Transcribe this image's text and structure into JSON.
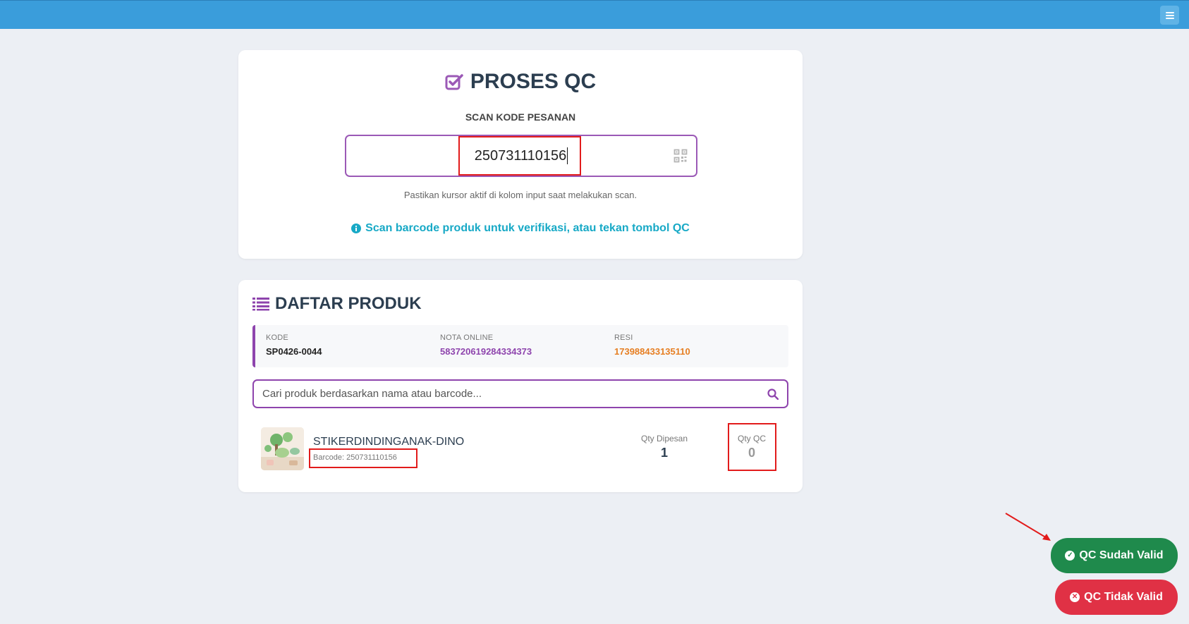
{
  "qc": {
    "title": "PROSES QC",
    "scan_label": "SCAN KODE PESANAN",
    "scan_value": "250731110156",
    "hint": "Pastikan kursor aktif di kolom input saat melakukan scan.",
    "info": "Scan barcode produk untuk verifikasi, atau tekan tombol QC"
  },
  "products": {
    "title": "DAFTAR PRODUK",
    "meta": {
      "kode_label": "KODE",
      "kode_value": "SP0426-0044",
      "nota_label": "NOTA ONLINE",
      "nota_value": "583720619284334373",
      "resi_label": "RESI",
      "resi_value": "173988433135110"
    },
    "search_placeholder": "Cari produk berdasarkan nama atau barcode...",
    "items": [
      {
        "name": "STIKERDINDINGANAK-DINO",
        "barcode": "Barcode: 250731110156",
        "qty_ordered_label": "Qty Dipesan",
        "qty_ordered": "1",
        "qty_qc_label": "Qty QC",
        "qty_qc": "0"
      }
    ]
  },
  "actions": {
    "valid_label": "QC Sudah Valid",
    "invalid_label": "QC Tidak Valid"
  },
  "colors": {
    "topbar": "#3a9ddb",
    "accent_purple": "#8e44ad",
    "info_cyan": "#17a9c6",
    "resi_orange": "#e67e22",
    "valid_green": "#1f8a4c",
    "invalid_red": "#e03145",
    "highlight_red": "#e21b1b"
  },
  "icons": {
    "menu": "menu-icon",
    "title_qc": "check-square-icon",
    "scan": "qrcode-icon",
    "info": "info-circle-icon",
    "list": "list-icon",
    "search": "search-icon",
    "valid": "check-circle-icon",
    "invalid": "times-circle-icon"
  }
}
